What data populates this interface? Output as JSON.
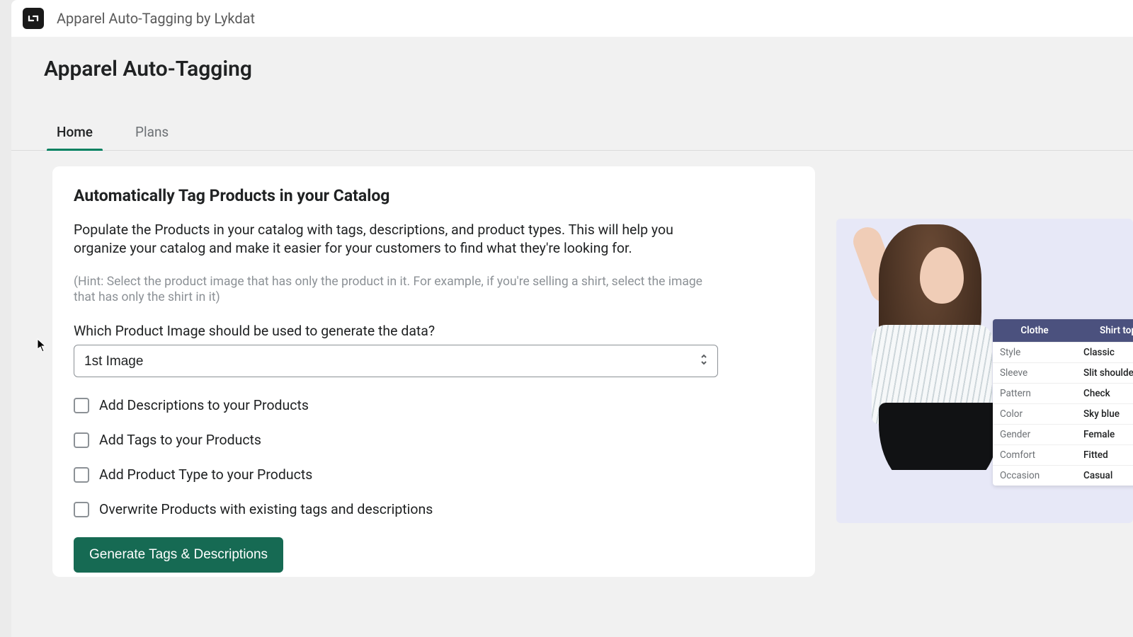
{
  "topbar": {
    "app_name": "Apparel Auto-Tagging by Lykdat"
  },
  "page_title": "Apparel Auto-Tagging",
  "tabs": [
    {
      "label": "Home",
      "active": true
    },
    {
      "label": "Plans",
      "active": false
    }
  ],
  "card": {
    "heading": "Automatically Tag Products in your Catalog",
    "description": "Populate the Products in your catalog with tags, descriptions, and product types. This will help you organize your catalog and make it easier for your customers to find what they're looking for.",
    "hint": "(Hint: Select the product image that has only the product in it. For example, if you're selling a shirt, select the image that has only the shirt in it)",
    "question_label": "Which Product Image should be used to generate the data?",
    "image_select": {
      "selected": "1st Image"
    },
    "checkboxes": [
      {
        "label": "Add Descriptions to your Products",
        "checked": false
      },
      {
        "label": "Add Tags to your Products",
        "checked": false
      },
      {
        "label": "Add Product Type to your Products",
        "checked": false
      },
      {
        "label": "Overwrite Products with existing tags and descriptions",
        "checked": false
      }
    ],
    "primary_button": "Generate Tags & Descriptions"
  },
  "demo_panel": {
    "header": {
      "left": "Clothe",
      "right": "Shirt top"
    },
    "rows": [
      {
        "k": "Style",
        "v": "Classic"
      },
      {
        "k": "Sleeve",
        "v": "Slit shoulder"
      },
      {
        "k": "Pattern",
        "v": "Check"
      },
      {
        "k": "Color",
        "v": "Sky blue"
      },
      {
        "k": "Gender",
        "v": "Female"
      },
      {
        "k": "Comfort",
        "v": "Fitted"
      },
      {
        "k": "Occasion",
        "v": "Casual"
      }
    ]
  }
}
